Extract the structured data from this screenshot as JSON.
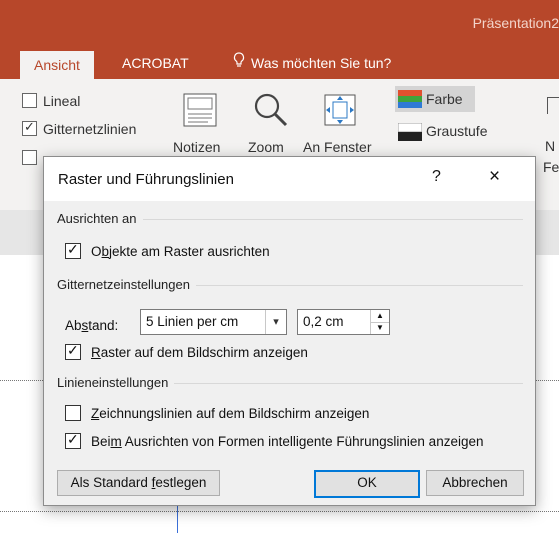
{
  "app": {
    "title": "Präsentation2"
  },
  "tabs": [
    {
      "label": "Ansicht",
      "active": true
    },
    {
      "label": "ACROBAT",
      "active": false
    }
  ],
  "tell_me": {
    "text": "Was möchten Sie tun?",
    "icon": "lightbulb-icon"
  },
  "ribbon": {
    "checkboxes": [
      {
        "label": "Lineal",
        "checked": false
      },
      {
        "label": "Gitternetzlinien",
        "checked": true
      },
      {
        "label": "",
        "checked": false
      }
    ],
    "buttons": {
      "notes": "Notizen",
      "zoom": "Zoom",
      "fit": "An Fenster",
      "color": "Farbe",
      "grayscale": "Graustufe",
      "partial_n": "N",
      "partial_fe": "Fe"
    }
  },
  "dialog": {
    "title": "Raster und Führungslinien",
    "help": "?",
    "close": "×",
    "section_snap": "Ausrichten an",
    "snap_objects": {
      "before": "O",
      "mnemonic": "b",
      "after": "jekte am Raster ausrichten",
      "checked": true
    },
    "section_grid": "Gitternetzeinstellungen",
    "spacing_label": {
      "before": "Ab",
      "mnemonic": "s",
      "after": "tand:"
    },
    "spacing_select": "5 Linien per cm",
    "spacing_value": "0,2  cm",
    "show_grid": {
      "before": "",
      "mnemonic": "R",
      "after": "aster auf dem Bildschirm anzeigen",
      "checked": true
    },
    "section_guides": "Linieneinstellungen",
    "show_guides": {
      "before": "",
      "mnemonic": "Z",
      "after": "eichnungslinien auf dem Bildschirm anzeigen",
      "checked": false
    },
    "smart_guides": {
      "before": "Bei",
      "mnemonic": "m",
      "after": " Ausrichten von Formen intelligente Führungslinien anzeigen",
      "checked": true
    },
    "btn_default": {
      "before": "Als Standard ",
      "mnemonic": "f",
      "after": "estlegen"
    },
    "btn_ok": "OK",
    "btn_cancel": "Abbrechen"
  },
  "colors": {
    "accent": "#b7472a",
    "focus": "#0078d7"
  }
}
